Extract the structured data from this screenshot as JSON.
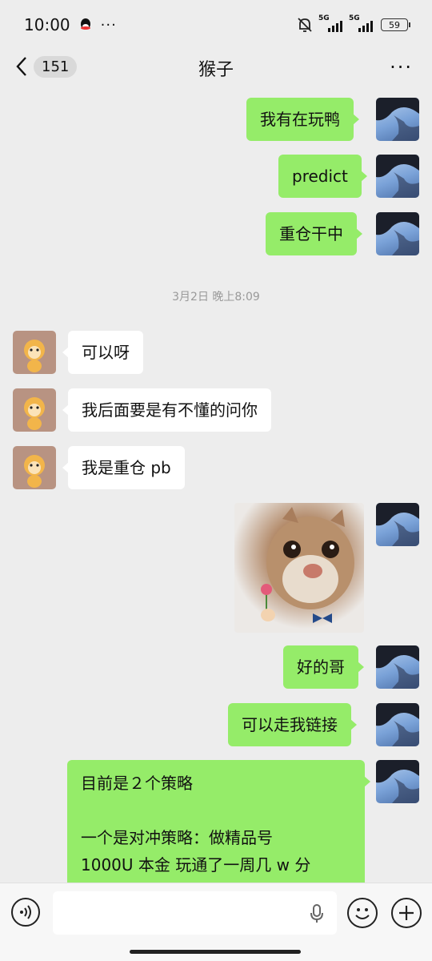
{
  "status_bar": {
    "time": "10:00",
    "dots": "···",
    "signal1_label": "5G",
    "signal2_label": "5G",
    "battery": "59"
  },
  "header": {
    "unread_count": "151",
    "title": "猴子",
    "more": "···"
  },
  "messages": [
    {
      "side": "me",
      "text": "我有在玩鸭"
    },
    {
      "side": "me",
      "text": "predict"
    },
    {
      "side": "me",
      "text": "重仓干中"
    },
    {
      "side": "them",
      "text": "可以呀"
    },
    {
      "side": "them",
      "text": "我后面要是有不懂的问你"
    },
    {
      "side": "them",
      "text": "我是重仓 pb"
    },
    {
      "side": "me",
      "text": "好的哥"
    },
    {
      "side": "me",
      "text": "可以走我链接"
    }
  ],
  "timestamp": "3月2日 晚上8:09",
  "long_message": {
    "line1": "目前是２个策略",
    "line2": "一个是对冲策略：做精品号",
    "line3": "1000U 本金 玩通了一周几 w 分"
  },
  "input": {
    "placeholder": ""
  },
  "colors": {
    "my_bubble": "#95ec69",
    "their_bubble": "#ffffff",
    "background": "#ededed"
  }
}
